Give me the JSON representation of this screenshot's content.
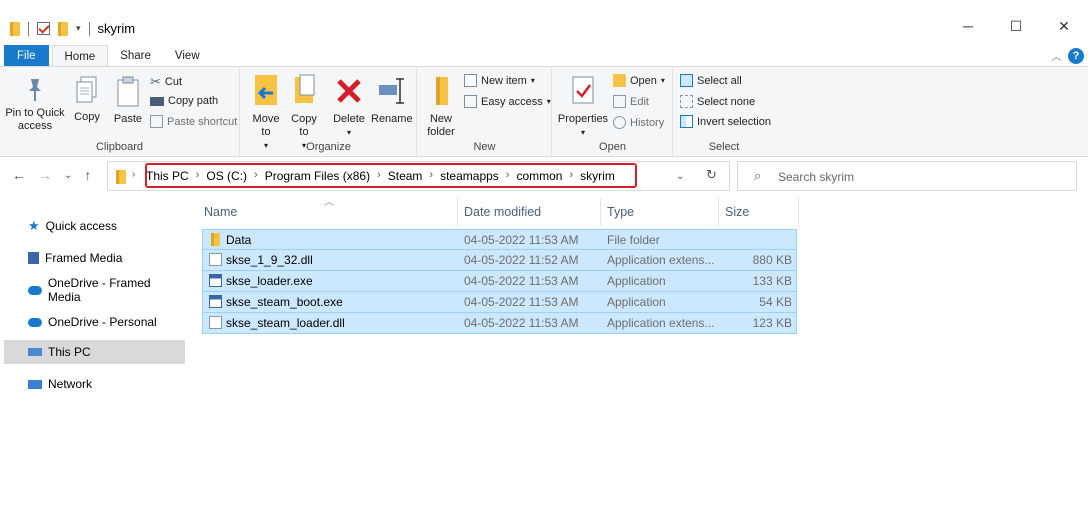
{
  "window": {
    "title": "skyrim",
    "minimize": "─",
    "maximize": "☐",
    "close": "✕"
  },
  "tabs": {
    "file": "File",
    "home": "Home",
    "share": "Share",
    "view": "View"
  },
  "ribbon": {
    "clipboard": {
      "label": "Clipboard",
      "pin": "Pin to Quick access",
      "copy": "Copy",
      "paste": "Paste",
      "cut": "Cut",
      "copy_path": "Copy path",
      "paste_shortcut": "Paste shortcut"
    },
    "organize": {
      "label": "Organize",
      "move_to": "Move to",
      "copy_to": "Copy to",
      "delete": "Delete",
      "rename": "Rename"
    },
    "new": {
      "label": "New",
      "new_folder": "New folder",
      "new_item": "New item",
      "easy_access": "Easy access"
    },
    "open": {
      "label": "Open",
      "properties": "Properties",
      "open": "Open",
      "edit": "Edit",
      "history": "History"
    },
    "select": {
      "label": "Select",
      "select_all": "Select all",
      "select_none": "Select none",
      "invert": "Invert selection"
    }
  },
  "address": {
    "crumbs": [
      "This PC",
      "OS (C:)",
      "Program Files (x86)",
      "Steam",
      "steamapps",
      "common",
      "skyrim"
    ],
    "search_placeholder": "Search skyrim"
  },
  "nav": {
    "items": [
      "Quick access",
      "Framed Media",
      "OneDrive - Framed Media",
      "OneDrive - Personal",
      "This PC",
      "Network"
    ]
  },
  "columns": {
    "name": "Name",
    "date": "Date modified",
    "type": "Type",
    "size": "Size"
  },
  "files": [
    {
      "name": "Data",
      "date": "04-05-2022 11:53 AM",
      "type": "File folder",
      "size": ""
    },
    {
      "name": "skse_1_9_32.dll",
      "date": "04-05-2022 11:52 AM",
      "type": "Application extens...",
      "size": "880 KB"
    },
    {
      "name": "skse_loader.exe",
      "date": "04-05-2022 11:53 AM",
      "type": "Application",
      "size": "133 KB"
    },
    {
      "name": "skse_steam_boot.exe",
      "date": "04-05-2022 11:53 AM",
      "type": "Application",
      "size": "54 KB"
    },
    {
      "name": "skse_steam_loader.dll",
      "date": "04-05-2022 11:53 AM",
      "type": "Application extens...",
      "size": "123 KB"
    }
  ],
  "colors": {
    "accent": "#1979ca",
    "selection": "#cce8ff",
    "highlight_box": "#d21f2a"
  }
}
